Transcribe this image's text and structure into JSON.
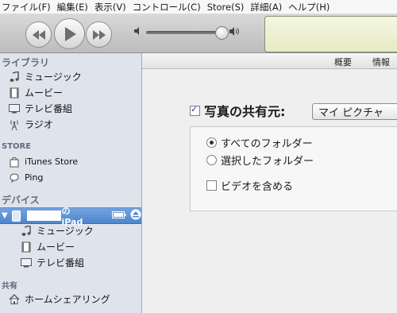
{
  "menu": [
    "ファイル(F)",
    "編集(E)",
    "表示(V)",
    "コントロール(C)",
    "Store(S)",
    "詳細(A)",
    "ヘルプ(H)"
  ],
  "sidebar": {
    "library_header": "ライブラリ",
    "library_items": [
      "ミュージック",
      "ムービー",
      "テレビ番組",
      "ラジオ"
    ],
    "store_header": "STORE",
    "store_items": [
      "iTunes Store",
      "Ping"
    ],
    "devices_header": "デバイス",
    "device_name_suffix": "の iPad",
    "device_items": [
      "ミュージック",
      "ムービー",
      "テレビ番組"
    ],
    "shared_header": "共有",
    "shared_items": [
      "ホームシェアリング"
    ]
  },
  "tabs": [
    "概要",
    "情報"
  ],
  "photos": {
    "sync_label": "写真の共有元:",
    "sync_checked": true,
    "source_value": "マイ ピクチャ",
    "options": [
      "すべてのフォルダー",
      "選択したフォルダー"
    ],
    "selected_option": 0,
    "include_video_label": "ビデオを含める",
    "include_video_checked": false
  }
}
